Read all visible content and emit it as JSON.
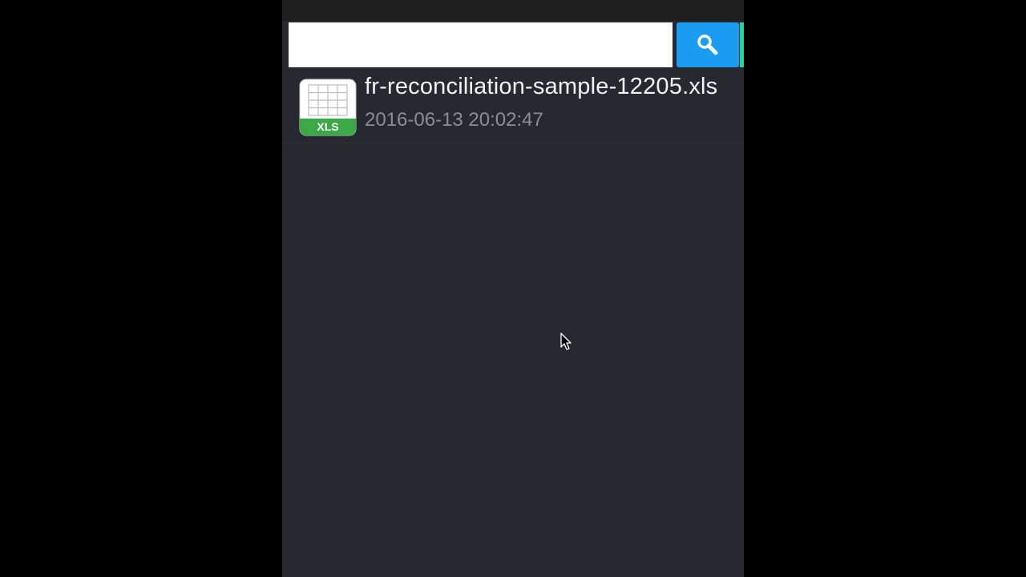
{
  "search": {
    "value": "",
    "placeholder": ""
  },
  "search_button": {
    "icon": "search-icon"
  },
  "files": [
    {
      "name": "fr-reconciliation-sample-12205.xls",
      "date": "2016-06-13 20:02:47",
      "type_label": "XLS",
      "icon": "spreadsheet-xls-icon"
    }
  ],
  "colors": {
    "screen_bg": "#262930",
    "search_button": "#1a9cf0",
    "accent_edge": "#17d9a3",
    "xls_badge": "#3aa846"
  }
}
